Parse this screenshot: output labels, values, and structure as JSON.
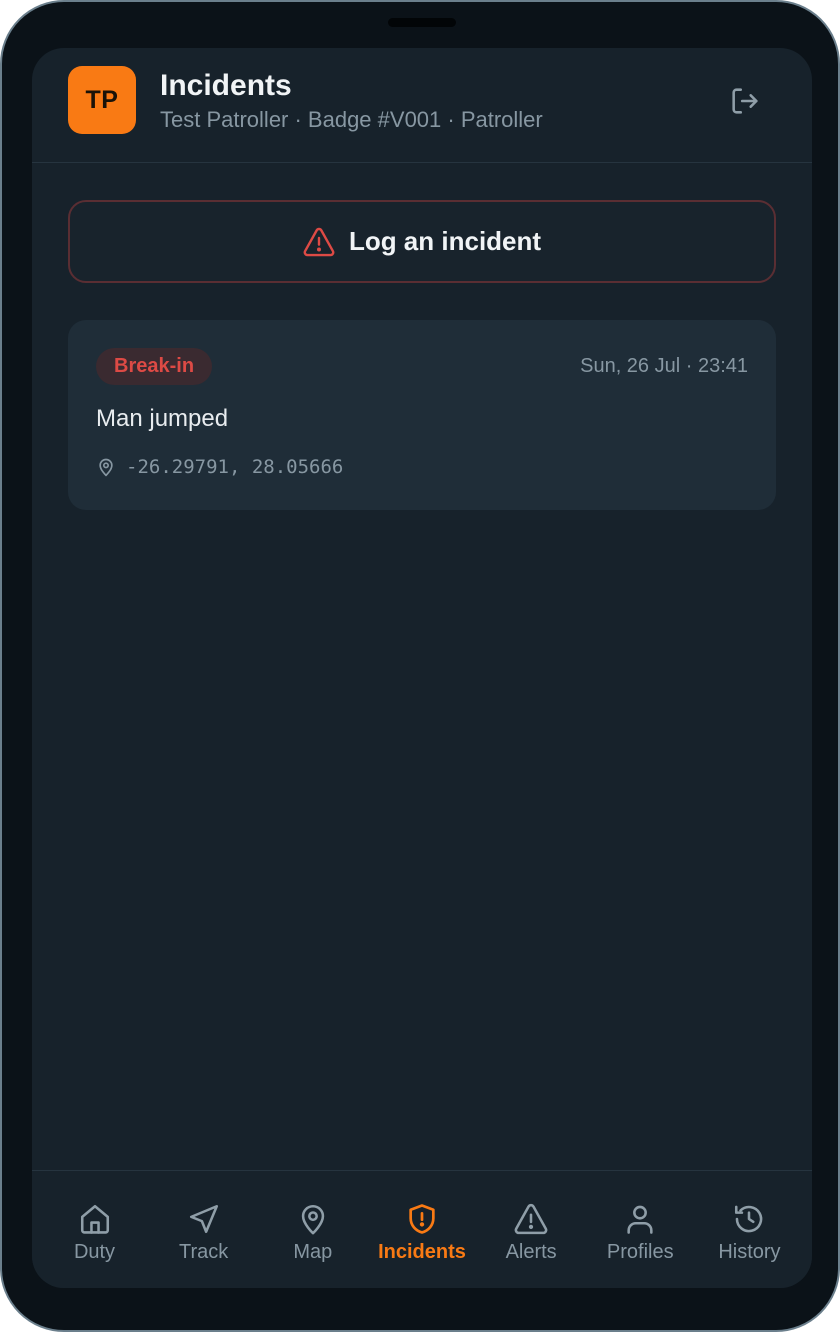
{
  "header": {
    "avatar_initials": "TP",
    "title": "Incidents",
    "subtitle": "Test Patroller · Badge #V001 · Patroller",
    "logout_icon": "logout-icon"
  },
  "actions": {
    "log_incident_label": "Log an incident",
    "log_incident_icon": "warning-triangle-icon"
  },
  "incidents": [
    {
      "category": "Break-in",
      "timestamp": "Sun, 26 Jul · 23:41",
      "description": "Man jumped",
      "coordinates": "-26.29791, 28.05666"
    }
  ],
  "nav": {
    "items": [
      {
        "label": "Duty",
        "icon": "home-icon"
      },
      {
        "label": "Track",
        "icon": "navigation-arrow-icon"
      },
      {
        "label": "Map",
        "icon": "map-pin-icon"
      },
      {
        "label": "Incidents",
        "icon": "shield-alert-icon",
        "active": true
      },
      {
        "label": "Alerts",
        "icon": "warning-triangle-icon"
      },
      {
        "label": "Profiles",
        "icon": "user-icon"
      },
      {
        "label": "History",
        "icon": "history-icon"
      }
    ]
  },
  "colors": {
    "accent": "#f97a14",
    "danger": "#dd4a45",
    "background": "#17222b",
    "card": "#1f2d38",
    "muted_text": "#8797a2"
  }
}
